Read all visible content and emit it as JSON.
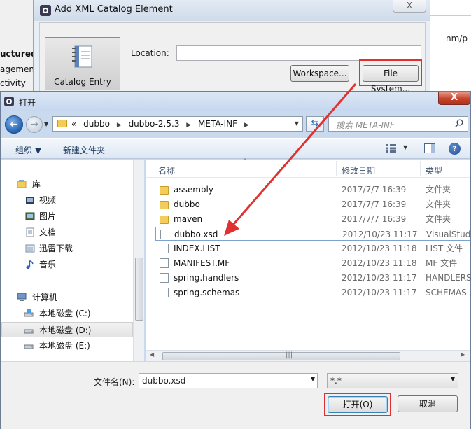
{
  "background": {
    "left_texts": [
      "uctured",
      "agement",
      "ctivity"
    ],
    "right_path": "nm/p"
  },
  "xml_dialog": {
    "title": "Add XML Catalog Element",
    "close": "X",
    "catalog_entry_label": "Catalog Entry",
    "location_label": "Location:",
    "location_value": "",
    "workspace_button": "Workspace...",
    "file_system_button": "File System..."
  },
  "open_dialog": {
    "title": "打开",
    "close": "X",
    "breadcrumb_prefix": "«",
    "breadcrumbs": [
      "dubbo",
      "dubbo-2.5.3",
      "META-INF"
    ],
    "search_placeholder": "搜索 META-INF",
    "toolbar": {
      "organize": "组织 ▼",
      "new_folder": "新建文件夹"
    },
    "nav": {
      "library": "库",
      "items": [
        "视频",
        "图片",
        "文档",
        "迅雷下载",
        "音乐"
      ],
      "computer": "计算机",
      "drives": [
        "本地磁盘 (C:)",
        "本地磁盘 (D:)",
        "本地磁盘 (E:)"
      ]
    },
    "columns": {
      "name": "名称",
      "date": "修改日期",
      "type": "类型"
    },
    "files": [
      {
        "name": "assembly",
        "date": "2017/7/7 16:39",
        "type": "文件夹",
        "kind": "folder"
      },
      {
        "name": "dubbo",
        "date": "2017/7/7 16:39",
        "type": "文件夹",
        "kind": "folder"
      },
      {
        "name": "maven",
        "date": "2017/7/7 16:39",
        "type": "文件夹",
        "kind": "folder"
      },
      {
        "name": "dubbo.xsd",
        "date": "2012/10/23 11:17",
        "type": "VisualStudi",
        "kind": "doc"
      },
      {
        "name": "INDEX.LIST",
        "date": "2012/10/23 11:18",
        "type": "LIST 文件",
        "kind": "doc"
      },
      {
        "name": "MANIFEST.MF",
        "date": "2012/10/23 11:18",
        "type": "MF 文件",
        "kind": "doc"
      },
      {
        "name": "spring.handlers",
        "date": "2012/10/23 11:17",
        "type": "HANDLERS",
        "kind": "doc"
      },
      {
        "name": "spring.schemas",
        "date": "2012/10/23 11:17",
        "type": "SCHEMAS 文",
        "kind": "doc"
      }
    ],
    "filename_label": "文件名(N):",
    "filename_value": "dubbo.xsd",
    "filter_value": "*.*",
    "open_button": "打开(O)",
    "cancel_button": "取消"
  },
  "annotation_color": "#e03030"
}
